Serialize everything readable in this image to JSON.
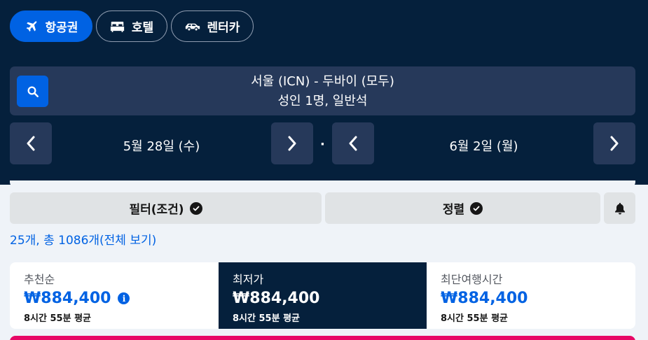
{
  "tabs": [
    {
      "label": "항공권",
      "icon": "airplane-icon",
      "active": true
    },
    {
      "label": "호텔",
      "icon": "bed-icon",
      "active": false
    },
    {
      "label": "렌터카",
      "icon": "car-icon",
      "active": false
    }
  ],
  "search": {
    "route": "서울 (ICN) - 두바이 (모두)",
    "passengers": "성인 1명, 일반석"
  },
  "dates": {
    "depart": "5월 28일 (수)",
    "separator": "·",
    "return": "6월 2일 (월)"
  },
  "filters": {
    "filter_label": "필터(조건)",
    "sort_label": "정렬"
  },
  "results": {
    "count_text": "25개, 총 1086개(전체 보기)"
  },
  "sort_options": [
    {
      "label": "추천순",
      "price": "₩884,400",
      "avg": "8시간 55분 평균",
      "selected": false,
      "has_info": true
    },
    {
      "label": "최저가",
      "price": "₩884,400",
      "avg": "8시간 55분 평균",
      "selected": true,
      "has_info": false
    },
    {
      "label": "최단여행시간",
      "price": "₩884,400",
      "avg": "8시간 55분 평균",
      "selected": false,
      "has_info": false
    }
  ],
  "colors": {
    "header_bg": "#05203c",
    "accent": "#0062e3",
    "field_bg": "#26395a",
    "page_bg": "#eff3f8",
    "banner": "#e70866"
  }
}
